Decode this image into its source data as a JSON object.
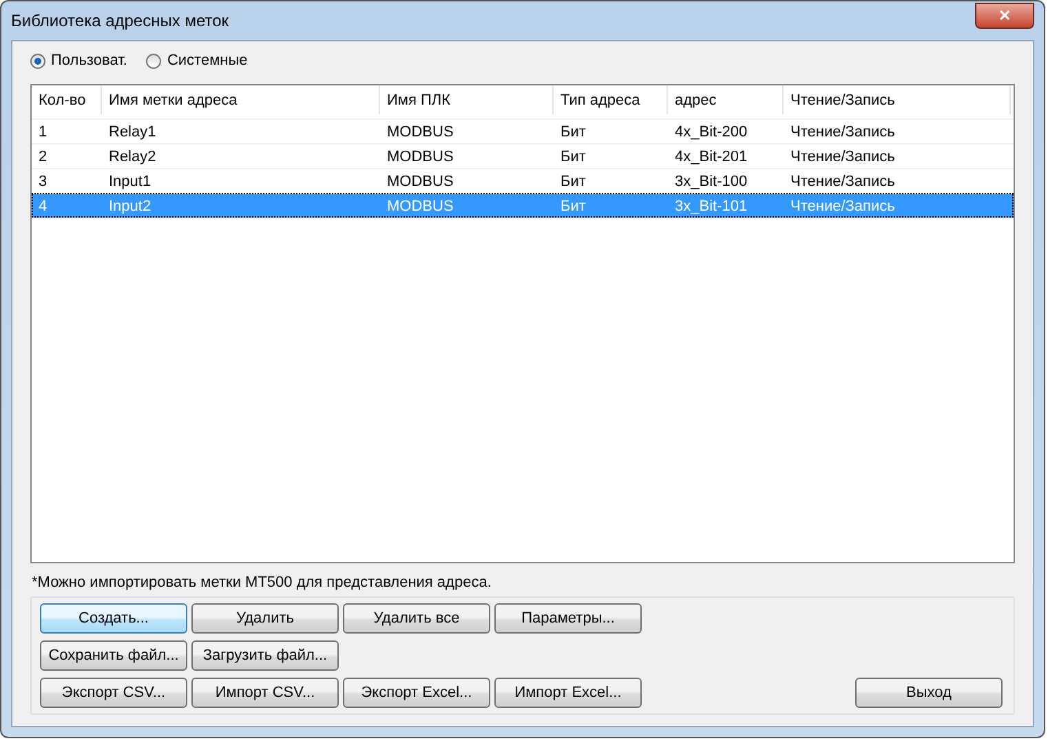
{
  "window": {
    "title": "Библиотека адресных меток",
    "close": "✕"
  },
  "radios": [
    {
      "label": "Пользоват.",
      "selected": true
    },
    {
      "label": "Системные",
      "selected": false
    }
  ],
  "table": {
    "columns": [
      "Кол-во",
      "Имя метки адреса",
      "Имя ПЛК",
      "Тип адреса",
      "адрес",
      "Чтение/Запись"
    ],
    "rows": [
      {
        "cells": [
          "1",
          "Relay1",
          "MODBUS",
          "Бит",
          "4x_Bit-200",
          "Чтение/Запись"
        ],
        "selected": false
      },
      {
        "cells": [
          "2",
          "Relay2",
          "MODBUS",
          "Бит",
          "4x_Bit-201",
          "Чтение/Запись"
        ],
        "selected": false
      },
      {
        "cells": [
          "3",
          "Input1",
          "MODBUS",
          "Бит",
          "3x_Bit-100",
          "Чтение/Запись"
        ],
        "selected": false
      },
      {
        "cells": [
          "4",
          "Input2",
          "MODBUS",
          "Бит",
          "3x_Bit-101",
          "Чтение/Запись"
        ],
        "selected": true
      }
    ]
  },
  "note": "*Можно импортировать метки MT500 для представления адреса.",
  "button_rows": [
    [
      {
        "label": "Создать...",
        "default": true
      },
      {
        "label": "Удалить",
        "default": false
      },
      {
        "label": "Удалить все",
        "default": false
      },
      {
        "label": "Параметры...",
        "default": false
      }
    ],
    [
      {
        "label": "Сохранить файл...",
        "default": false
      },
      {
        "label": "Загрузить файл...",
        "default": false
      }
    ],
    [
      {
        "label": "Экспорт CSV...",
        "default": false
      },
      {
        "label": "Импорт CSV...",
        "default": false
      },
      {
        "label": "Экспорт Excel...",
        "default": false
      },
      {
        "label": "Импорт Excel...",
        "default": false
      }
    ]
  ],
  "exit_button": "Выход"
}
